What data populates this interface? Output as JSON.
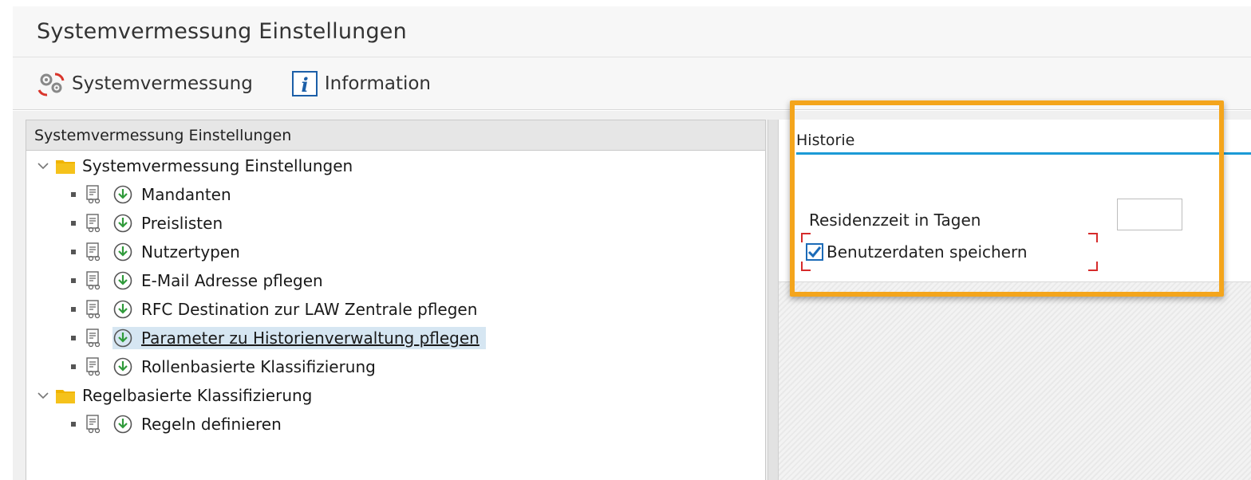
{
  "window": {
    "title": "Systemvermessung Einstellungen"
  },
  "toolbar": {
    "system_label": "Systemvermessung",
    "info_label": "Information"
  },
  "tree": {
    "header": "Systemvermessung Einstellungen",
    "folders": [
      {
        "label": "Systemvermessung Einstellungen",
        "items": [
          "Mandanten",
          "Preislisten",
          "Nutzertypen",
          "E-Mail Adresse pflegen",
          "RFC Destination zur LAW Zentrale pflegen",
          "Parameter zu Historienverwaltung pflegen",
          "Rollenbasierte Klassifizierung"
        ],
        "selected_index": 5
      },
      {
        "label": "Regelbasierte Klassifizierung",
        "items": [
          "Regeln definieren"
        ]
      }
    ]
  },
  "detail": {
    "group_title": "Historie",
    "residence_label": "Residenzzeit in Tagen",
    "residence_value": "",
    "save_userdata_label": "Benutzerdaten speichern",
    "save_userdata_checked": true
  },
  "colors": {
    "highlight": "#f4a51c",
    "accent_blue": "#1c9ad6",
    "selection": "#d6e6f2",
    "folder": "#f0b400",
    "exec_green": "#2f9a3a"
  }
}
